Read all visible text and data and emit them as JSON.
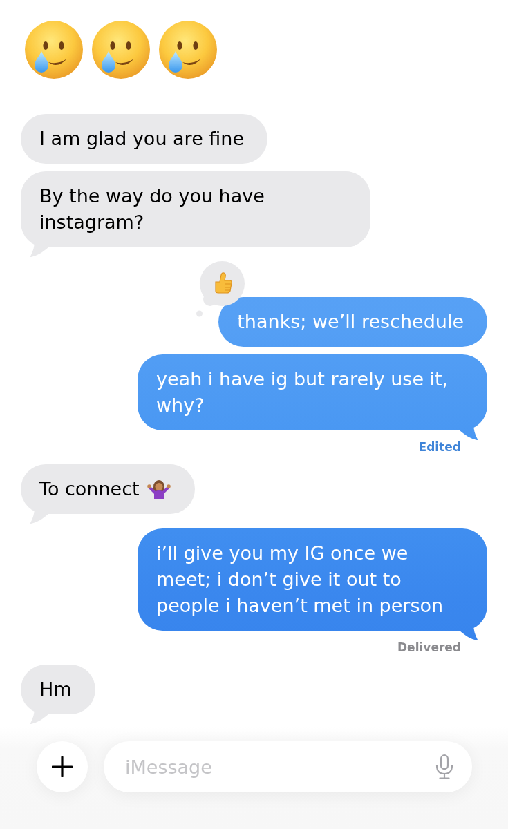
{
  "messages": [
    {
      "kind": "jumbo_emoji",
      "emojis": [
        {
          "kind": "smiling_face_with_tear"
        },
        {
          "kind": "smiling_face_with_tear"
        },
        {
          "kind": "smiling_face_with_tear"
        }
      ]
    },
    {
      "kind": "bubble",
      "sent": false,
      "text": "I am glad you are fine",
      "tail": false
    },
    {
      "kind": "bubble",
      "sent": false,
      "text": "By the way do you have instagram?",
      "tail": true
    },
    {
      "kind": "bubble",
      "sent": true,
      "text": "thanks; we’ll reschedule",
      "tail": false,
      "reaction": {
        "kind": "thumbs_up"
      }
    },
    {
      "kind": "bubble",
      "sent": true,
      "text": "yeah i have ig but rarely use it, why?",
      "tail": true,
      "status": {
        "kind": "edited",
        "text": "Edited"
      }
    },
    {
      "kind": "bubble",
      "sent": false,
      "text": "To connect",
      "emoji": {
        "kind": "shrug"
      },
      "tail": true
    },
    {
      "kind": "bubble",
      "sent": true,
      "text": "i’ll give you my IG once we meet; i don’t give it out to people i haven’t met in person",
      "tail": true,
      "status": {
        "kind": "delivered",
        "text": "Delivered"
      }
    },
    {
      "kind": "bubble",
      "sent": false,
      "text": "Hm",
      "tail": true
    }
  ],
  "composer": {
    "placeholder": "iMessage"
  }
}
